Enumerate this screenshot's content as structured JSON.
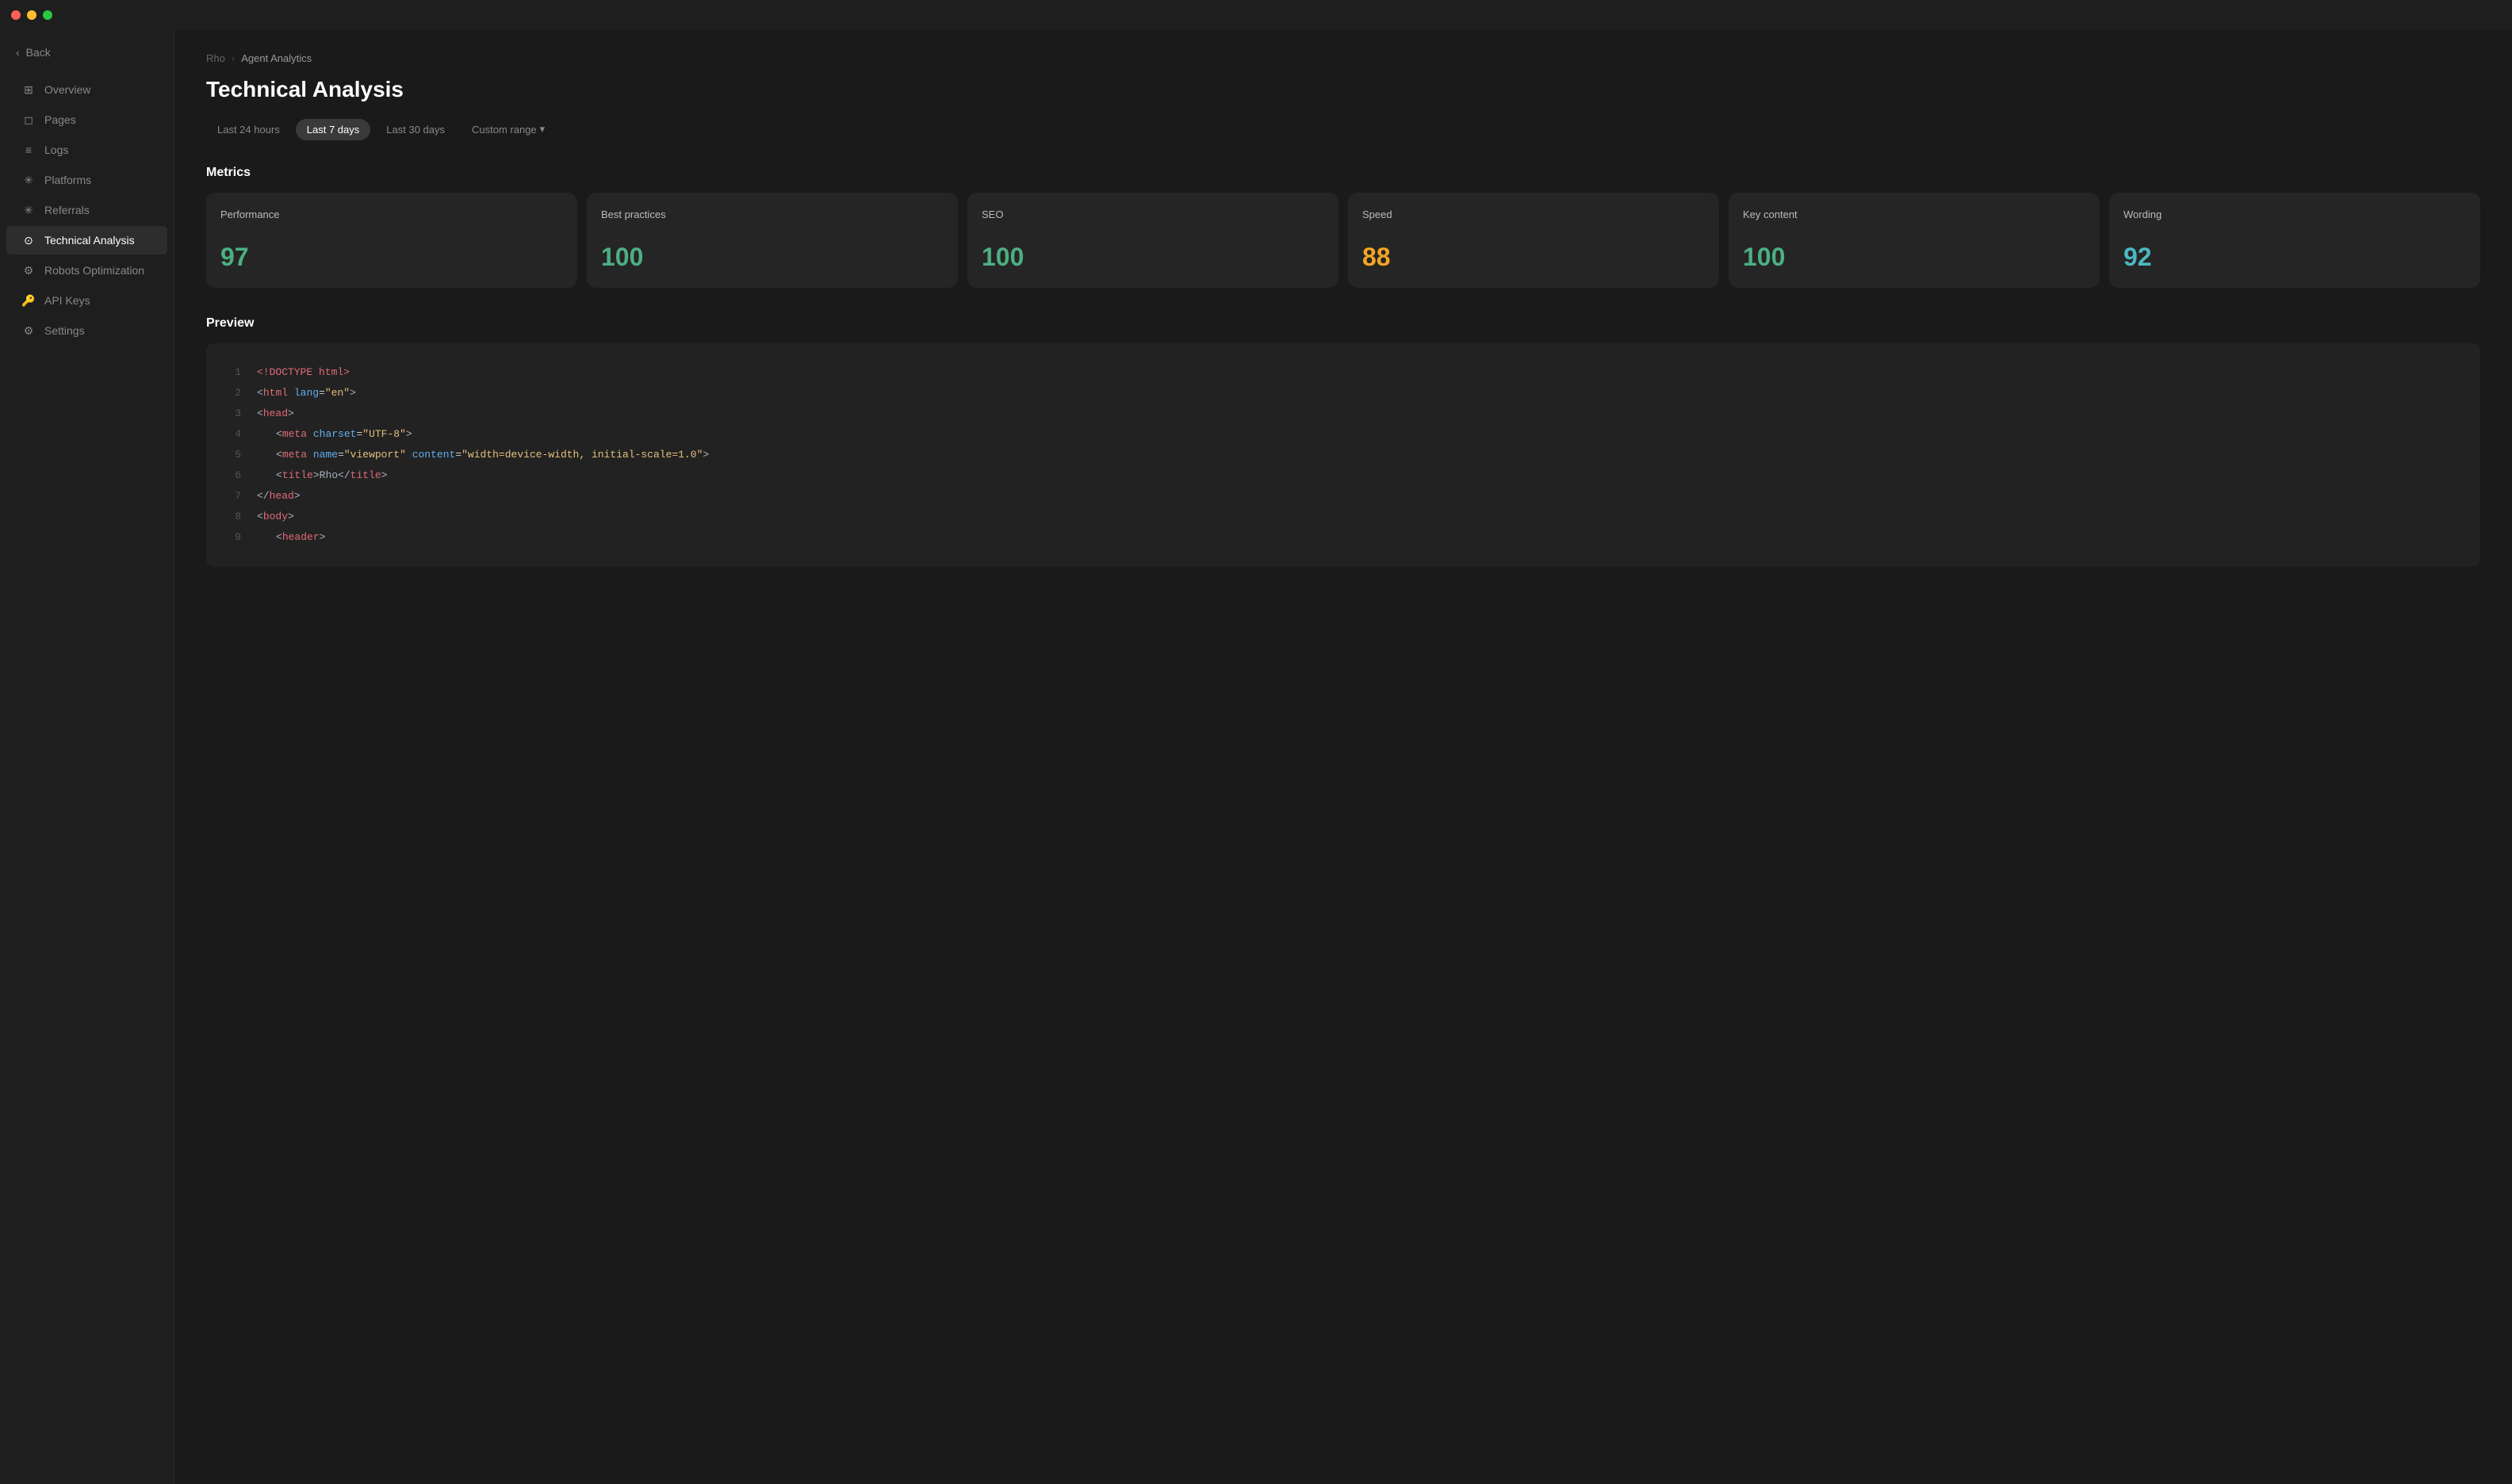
{
  "titlebar": {
    "dots": [
      "dot-red",
      "dot-yellow",
      "dot-green"
    ]
  },
  "sidebar": {
    "back_label": "Back",
    "items": [
      {
        "id": "overview",
        "label": "Overview",
        "icon": "⊞",
        "active": false
      },
      {
        "id": "pages",
        "label": "Pages",
        "icon": "📄",
        "active": false
      },
      {
        "id": "logs",
        "label": "Logs",
        "icon": "≡",
        "active": false
      },
      {
        "id": "platforms",
        "label": "Platforms",
        "icon": "✳",
        "active": false
      },
      {
        "id": "referrals",
        "label": "Referrals",
        "icon": "✳",
        "active": false
      },
      {
        "id": "technical-analysis",
        "label": "Technical Analysis",
        "icon": "⊙",
        "active": true
      },
      {
        "id": "robots-optimization",
        "label": "Robots Optimization",
        "icon": "⚙",
        "active": false
      },
      {
        "id": "api-keys",
        "label": "API Keys",
        "icon": "🔑",
        "active": false
      },
      {
        "id": "settings",
        "label": "Settings",
        "icon": "⚙",
        "active": false
      }
    ]
  },
  "breadcrumb": {
    "root": "Rho",
    "separator": "›",
    "current": "Agent Analytics"
  },
  "header": {
    "title": "Technical Analysis"
  },
  "time_filters": {
    "options": [
      {
        "id": "24h",
        "label": "Last 24 hours",
        "active": false
      },
      {
        "id": "7d",
        "label": "Last 7 days",
        "active": true
      },
      {
        "id": "30d",
        "label": "Last 30 days",
        "active": false
      }
    ],
    "dropdown_label": "Custom range",
    "dropdown_icon": "▾"
  },
  "metrics": {
    "section_title": "Metrics",
    "cards": [
      {
        "name": "Performance",
        "value": "97",
        "color": "green"
      },
      {
        "name": "Best practices",
        "value": "100",
        "color": "green"
      },
      {
        "name": "SEO",
        "value": "100",
        "color": "green"
      },
      {
        "name": "Speed",
        "value": "88",
        "color": "orange"
      },
      {
        "name": "Key content",
        "value": "100",
        "color": "green"
      },
      {
        "name": "Wording",
        "value": "92",
        "color": "teal"
      }
    ]
  },
  "preview": {
    "section_title": "Preview",
    "lines": [
      {
        "num": "1",
        "content": "<!DOCTYPE html>"
      },
      {
        "num": "2",
        "content": "<html lang=\"en\">"
      },
      {
        "num": "3",
        "content": "<head>"
      },
      {
        "num": "4",
        "content": "    <meta charset=\"UTF-8\">"
      },
      {
        "num": "5",
        "content": "    <meta name=\"viewport\" content=\"width=device-width, initial-scale=1.0\">"
      },
      {
        "num": "6",
        "content": "    <title>Rho</title>"
      },
      {
        "num": "7",
        "content": "</head>"
      },
      {
        "num": "8",
        "content": "<body>"
      },
      {
        "num": "9",
        "content": "    <header>"
      }
    ]
  }
}
